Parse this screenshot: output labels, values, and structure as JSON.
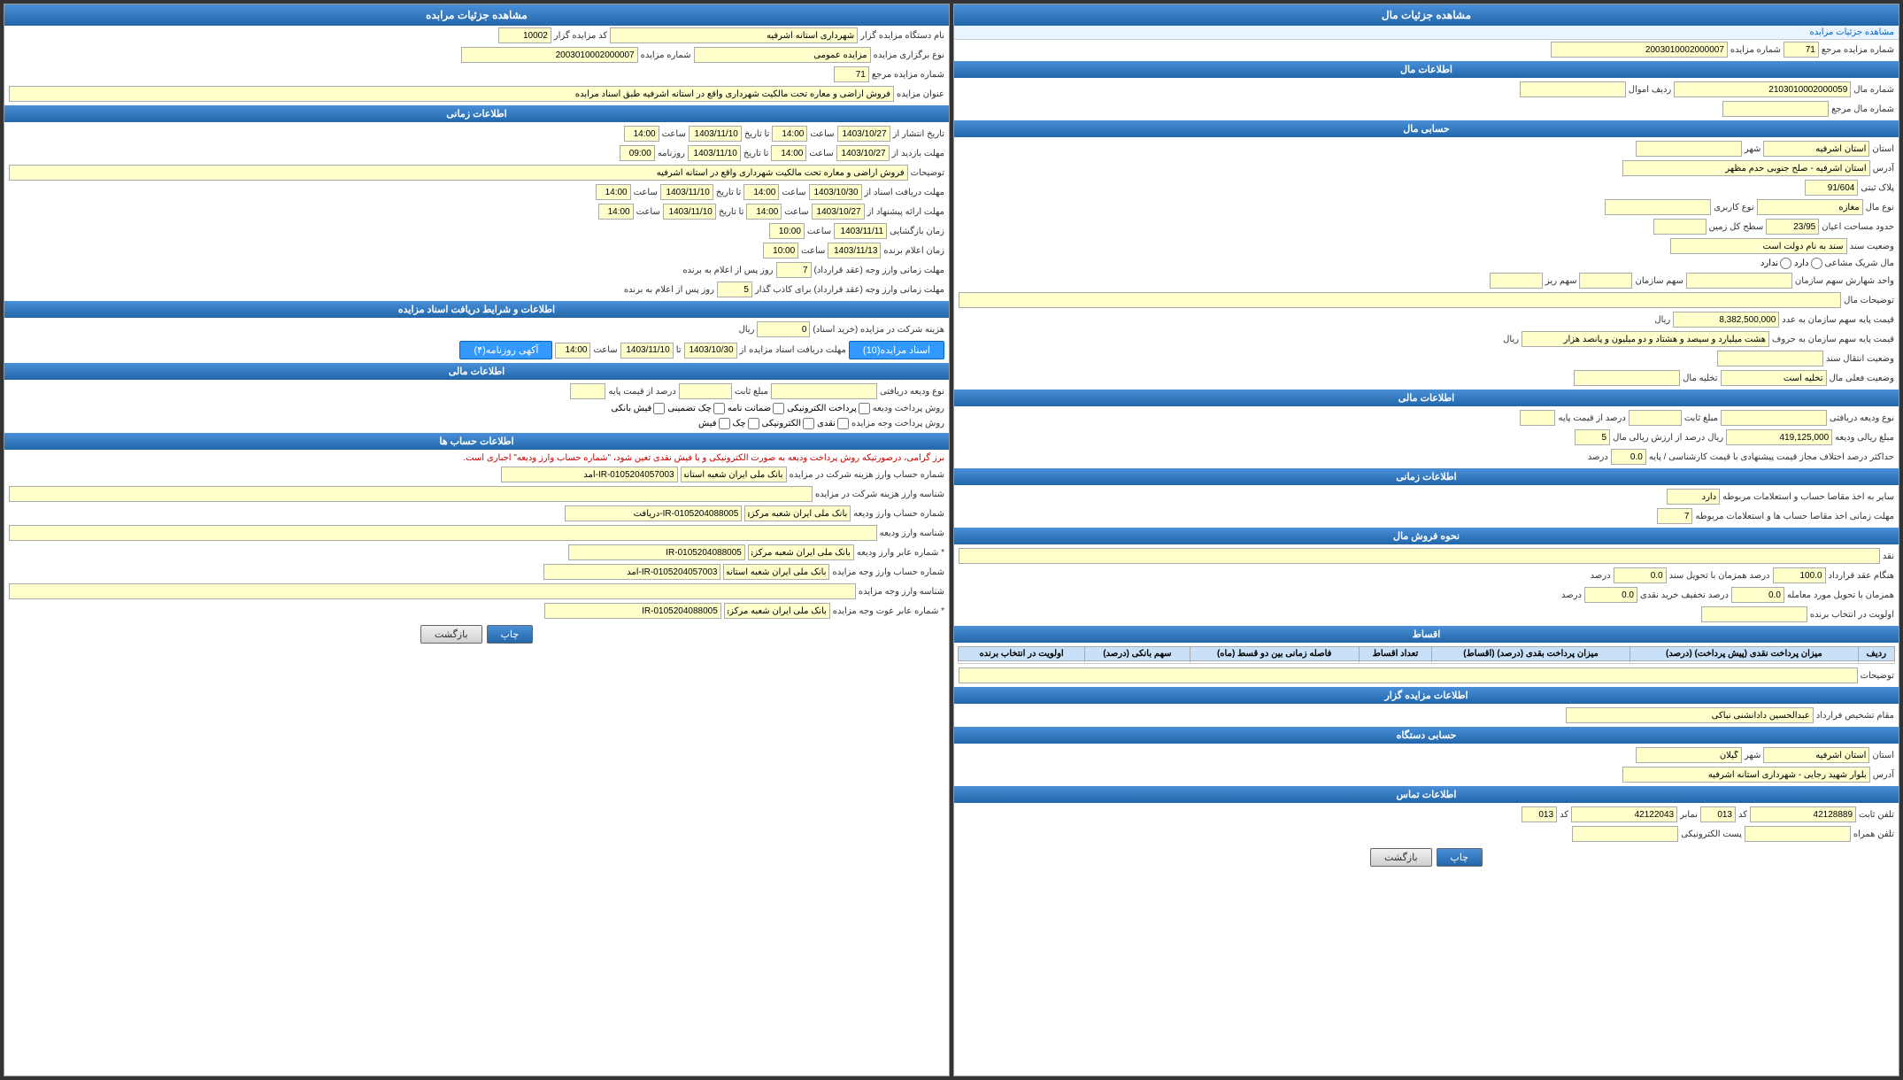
{
  "left_panel": {
    "title": "مشاهده جزئیات مال",
    "breadcrumb": "مشاهده جزئیات مرابده",
    "ref_number_label": "شماره مزایده مرجع",
    "ref_number_value": "71",
    "auction_number_label": "شماره مزایده",
    "auction_number_value": "2003010002000007",
    "mal_section": "اطلاعات مال",
    "mal_number_label": "شماره مال",
    "mal_number_value": "2103010002000059",
    "mal_revenue_label": "ردیف اموال",
    "mal_revenue_value": "",
    "mal_ref_label": "شماره مال مرجع",
    "mal_ref_value": "",
    "hesab_section": "حسابی مال",
    "province_label": "استان",
    "province_value": "استان اشرفیه",
    "city_label": "شهر",
    "city_value": "",
    "address_label": "آدرس",
    "address_value": "استان اشرفیه - صلح جنوبی حدم مظهر",
    "plak_label": "پلاک ثبتی",
    "plak_value": "91/604",
    "mal_type_label": "نوع مال",
    "mal_type_value": "مغازه",
    "user_type_label": "نوع کاربری",
    "user_type_value": "",
    "area_aian_label": "حدود مساحت اعیان",
    "area_aian_value": "23/95",
    "area_ground_label": "سطح کل زمین",
    "area_ground_value": "",
    "sanad_label": "وضعیت سند",
    "sanad_value": "سند به نام دولت است",
    "sharik_label": "مال شریک مشاعی",
    "sharik_value": "دارد",
    "sharik_radio": "ندارد",
    "sahm_sazman_label": "واحد شهارش سهم سازمان",
    "sahm_sazman_value": "",
    "sahm_sazman2_label": "سهم سازمان",
    "sahm_sazman2_value": "",
    "sahm_riz_label": "سهم ریز",
    "sahm_riz_value": "",
    "description_label": "توضیحات مال",
    "description_value": "",
    "price_label": "قیمت پایه سهم سازمان به عدد",
    "price_value": "8,382,500,000",
    "price_unit": "ریال",
    "price_text_label": "قیمت پایه سهم سازمان به حروف",
    "price_text_value": "هشت میلیارد و سیصد و هشتاد و دو میلیون و پانصد هزار",
    "price_text_unit": "ریال",
    "sanad_transfer_label": "وضعیت انتقال سند",
    "sanad_transfer_value": "",
    "takhlie_label": "وضعیت فعلی مال",
    "takhlie_value": "تخلیه است",
    "takhlie2_label": "تخلیه مال",
    "takhlie2_value": "",
    "maliyat_section": "اطلاعات مالی",
    "vadie_type_label": "نوع ودیعه دریافتی",
    "vadie_type_value": "",
    "mablagh_label": "مبلغ ثابت",
    "mablagh_value": "",
    "darsad_label": "درصد از قیمت پایه",
    "darsad_value": "",
    "riyal_label": "مبلغ ریالی ودیعه",
    "riyal_value": "419,125,000",
    "riyal_unit": "ریال",
    "darsad2_label": "درصد از ارزش ریالی مال",
    "darsad2_value": "5",
    "hedad_label": "حداکثر درصد اختلاف مجاز قیمت پیشنهادی با قیمت کارشناسی / پایه",
    "hedad_value": "0.0",
    "hedad_unit": "درصد",
    "zamani_section": "اطلاعات زمانی",
    "hesab_label": "سایر به اخذ مقاصا حساب و استعلامات مربوطه",
    "hesab_value": "دارد",
    "mohlat_label": "مهلت زمانی اخذ مقاصا حساب ها و استعلامات مربوطه",
    "mohlat_value": "7",
    "foroosh_section": "نحوه فروش مال",
    "naghd_label": "نقد",
    "naghd_value": "",
    "angham_label": "هنگام عقد قرارداد",
    "angham_value": "100.0",
    "angham_unit": "درصد",
    "tahvil_label": "همزمان با تحویل سند",
    "tahvil_value": "0.0",
    "tahvil_unit": "درصد",
    "tahvil2_label": "همزمان با تحویل مورد معامله",
    "tahvil2_value": "0.0",
    "tahvil2_unit": "درصد",
    "takhfif_label": "تخفیف خرید نقدی",
    "takhfif_value": "0.0",
    "takhfif_unit": "درصد",
    "avaloiat_label": "اولویت در انتخاب برنده",
    "avaloiat_value": "",
    "aghsat_section": "اقساط",
    "table_headers": [
      "ردیف",
      "میزان پرداخت نقدی (پیش پرداخت) (درصد)",
      "میزان پرداخت بقدی (درصد) (اقساط)",
      "تعداد اقساط",
      "فاصله زمانی بین دو قسط (ماه)",
      "سهم بانکی (درصد)",
      "اولویت در انتخاب برنده"
    ],
    "table_rows": [],
    "notes_label": "توضیحات",
    "notes_value": "",
    "mozayde_section": "اطلاعات مزایده گزار",
    "moqam_label": "مقام تشخیص فرارداد",
    "moqam_value": "عبدالحسین دادانشنی نباکی",
    "dastigah_section": "حسابی دستگاه",
    "province2_label": "استان",
    "province2_value": "استان اشرفیه",
    "city2_label": "شهر",
    "city2_value": "گیلان",
    "address2_label": "آدرس",
    "address2_value": "بلوار شهید رجایی - شهرداری استانه اشرفیه",
    "contact_section": "اطلاعات تماس",
    "tel_label": "تلفن ثابت",
    "tel_value": "42128889",
    "tel_code": "013",
    "fax_label": "نمابر",
    "fax_value": "42122043",
    "fax_code": "013",
    "mobile_label": "تلفن همراه",
    "mobile_value": "",
    "email_label": "پست الکترونیکی",
    "email_value": "",
    "print_btn": "چاپ",
    "back_btn": "بازگشت"
  },
  "right_panel": {
    "title": "مشاهده جزئیات مرابده",
    "name_label": "نام دستگاه مزایده گزار",
    "name_value": "شهرداری استانه اشرفیه",
    "code_label": "کد مزایده گزار",
    "code_value": "10002",
    "type_label": "نوع برگزاری مزایده",
    "type_value": "مزایده عمومی",
    "number_label": "شماره مزایده",
    "number_value": "2003010002000007",
    "ref_label": "شماره مزایده مرجع",
    "ref_value": "71",
    "title_label": "عنوان مزایده",
    "title_value": "فروش اراضی و معاره تحت مالکیت شهرداری واقع در آستانه اشرفیه طبق اسناد مرابده",
    "zamani_section": "اطلاعات زمانی",
    "enteshar_label": "تاریخ انتشار از",
    "enteshar_from": "1403/10/27",
    "enteshar_from_time": "14:00",
    "enteshar_to": "1403/11/10",
    "enteshar_to_time": "14:00",
    "mohlat_label": "مهلت بازدید از",
    "mohlat_from": "1403/10/27",
    "mohlat_from_time": "14:00",
    "mohlat_to": "1403/11/10",
    "mohlat_to_time": "09:00",
    "description_label": "توضیحات",
    "description_value": "فروش اراضی و معاره تحت مالکیت شهرداری واقع در آستانه اشرفیه",
    "mohlat2_label": "مهلت دریافت اسناد از",
    "mohlat2_from": "1403/10/30",
    "mohlat2_from_time": "14:00",
    "mohlat2_to": "1403/11/10",
    "mohlat2_to_time": "14:00",
    "mohlat3_label": "مهلت ارائه پیشنهاد از",
    "mohlat3_from": "1403/10/27",
    "mohlat3_from_time": "14:00",
    "mohlat3_to": "1403/11/10",
    "mohlat3_to_time": "14:00",
    "bazgoshai_label": "زمان بازگشایی",
    "bazgoshai_date": "1403/11/11",
    "bazgoshai_time": "10:00",
    "برنده_label": "زمان اعلام برنده",
    "برنده_date": "1403/11/13",
    "برنده_time": "10:00",
    "mohlat_zarar_label": "مهلت زمانی وارز وجه (عقد قرارداد)",
    "mohlat_zarar_value": "7",
    "mohlat_zarar_unit": "روز پس از اعلام به برنده",
    "mohlat_vadie_label": "مهلت زمانی وارز وجه (عقد قرارداد) برای کاذب گذار",
    "mohlat_vadie_value": "5",
    "mohlat_vadie_unit": "روز پس از اعلام به برنده",
    "asnad_section": "اطلاعات و شرایط دریافت اسناد مزایده",
    "hariene_label": "هزینه شرکت در مزایده (خرید اسناد)",
    "hariene_value": "0",
    "hariene_unit": "ریال",
    "asnad_type_label": "اسناد مزایده(10)",
    "mohlat_asnad_label": "مهلت دریافت اسناد مزایده",
    "mohlat_asnad_from": "1403/10/30",
    "mohlat_asnad_to": "1403/11/10",
    "mohlat_asnad_time": "14:00",
    "akhi_label": "آکهی روزنامه(۴)",
    "maliyat_section": "اطلاعات مالی",
    "vadie_type_label": "نوع ودیعه دریافتی",
    "vadie_type_value": "",
    "mablagh_label": "مبلغ ثابت",
    "mablagh_value": "",
    "darsad_label": "درصد از قیمت پایه",
    "darsad_value": "",
    "vadie_text": "نوع ودیعه دریافتی",
    "foroosh_label": "روش پرداخت ودیعه",
    "payment_options": [
      "پرداخت الکترونیکی",
      "ضمانت نامه",
      "چک تضمینی",
      "فیش بانکی"
    ],
    "foroosh2_label": "روش پرداخت وجه مزایده",
    "payment2_options": [
      "نقدی",
      "الکترونیکی",
      "چک",
      "فیش"
    ],
    "hesab_section": "اطلاعات حساب ها",
    "info_text": "برز گرامی، درصورتیکه روش پرداخت ودیعه به صورت الکترونیکی و یا فیش نقدی تعین شود، \"شماره حساب وارز ودیعه\" اجباری است.",
    "accounts": [
      {
        "label": "شماره حساب وارز هزینه شرکت در مزایده",
        "bank": "بانک ملی ایران شعبه آستانه",
        "account": "IR-0105204057003",
        "sheba": ""
      },
      {
        "label": "شناسه وارز هزینه شرکت در مزایده",
        "value": ""
      },
      {
        "label": "شماره حساب وارز ودیعه",
        "bank": "بانک ملی ایران شعبه مرکزی",
        "account": "IR-0105204088005",
        "sheba": ""
      },
      {
        "label": "شناسه وارز ودیعه",
        "value": ""
      },
      {
        "label": "* شماره عابر وارز ودیعه",
        "bank": "بانک ملی ایران شعبه مرکزی",
        "account": "IR-0105204088005",
        "sheba": ""
      },
      {
        "label": "شماره حساب وارز وجه مزایده",
        "bank": "بانک ملی ایران شعبه آستانه",
        "account": "IR-0105204057003",
        "sheba": ""
      },
      {
        "label": "شناسه وارز وجه مزایده",
        "value": ""
      },
      {
        "label": "* شماره عابر عوت وجه مزایده",
        "bank": "بانک ملی ایران شعبه مرکزی",
        "account": "IR-0105204088005",
        "sheba": ""
      }
    ],
    "print_btn": "چاپ",
    "back_btn": "بازگشت"
  }
}
